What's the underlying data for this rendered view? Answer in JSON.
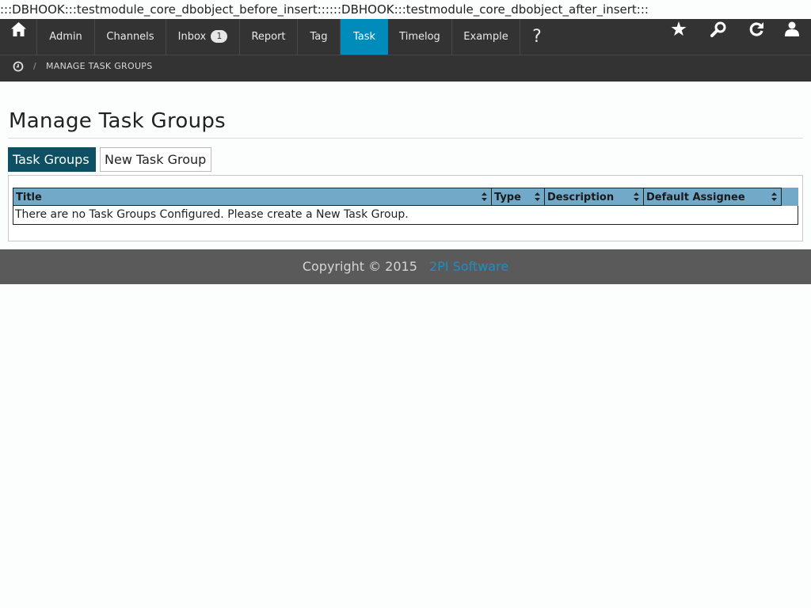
{
  "debug": ":::DBHOOK:::testmodule_core_dbobject_before_insert::::::DBHOOK:::testmodule_core_dbobject_after_insert:::",
  "nav": {
    "home_icon": "home-icon",
    "items": [
      {
        "label": "Admin"
      },
      {
        "label": "Channels"
      },
      {
        "label": "Inbox",
        "badge": "1"
      },
      {
        "label": "Report"
      },
      {
        "label": "Tag"
      },
      {
        "label": "Task",
        "active": true
      },
      {
        "label": "Timelog"
      },
      {
        "label": "Example"
      },
      {
        "label": "?"
      }
    ],
    "right_icons": [
      "star-icon",
      "search-icon",
      "refresh-icon",
      "user-icon"
    ],
    "active_color": "#008cba"
  },
  "breadcrumb": {
    "icon": "clock-icon",
    "separator": "/",
    "current": "MANAGE TASK GROUPS"
  },
  "page": {
    "title": "Manage Task Groups",
    "tabs": [
      {
        "label": "Task Groups",
        "active": true
      },
      {
        "label": "New Task Group",
        "active": false
      }
    ]
  },
  "table": {
    "columns": [
      "Title",
      "Type",
      "Description",
      "Default Assignee"
    ],
    "empty_message": "There are no Task Groups Configured. Please create a New Task Group."
  },
  "footer": {
    "copyright": "Copyright © 2015",
    "link": "2PI Software"
  }
}
